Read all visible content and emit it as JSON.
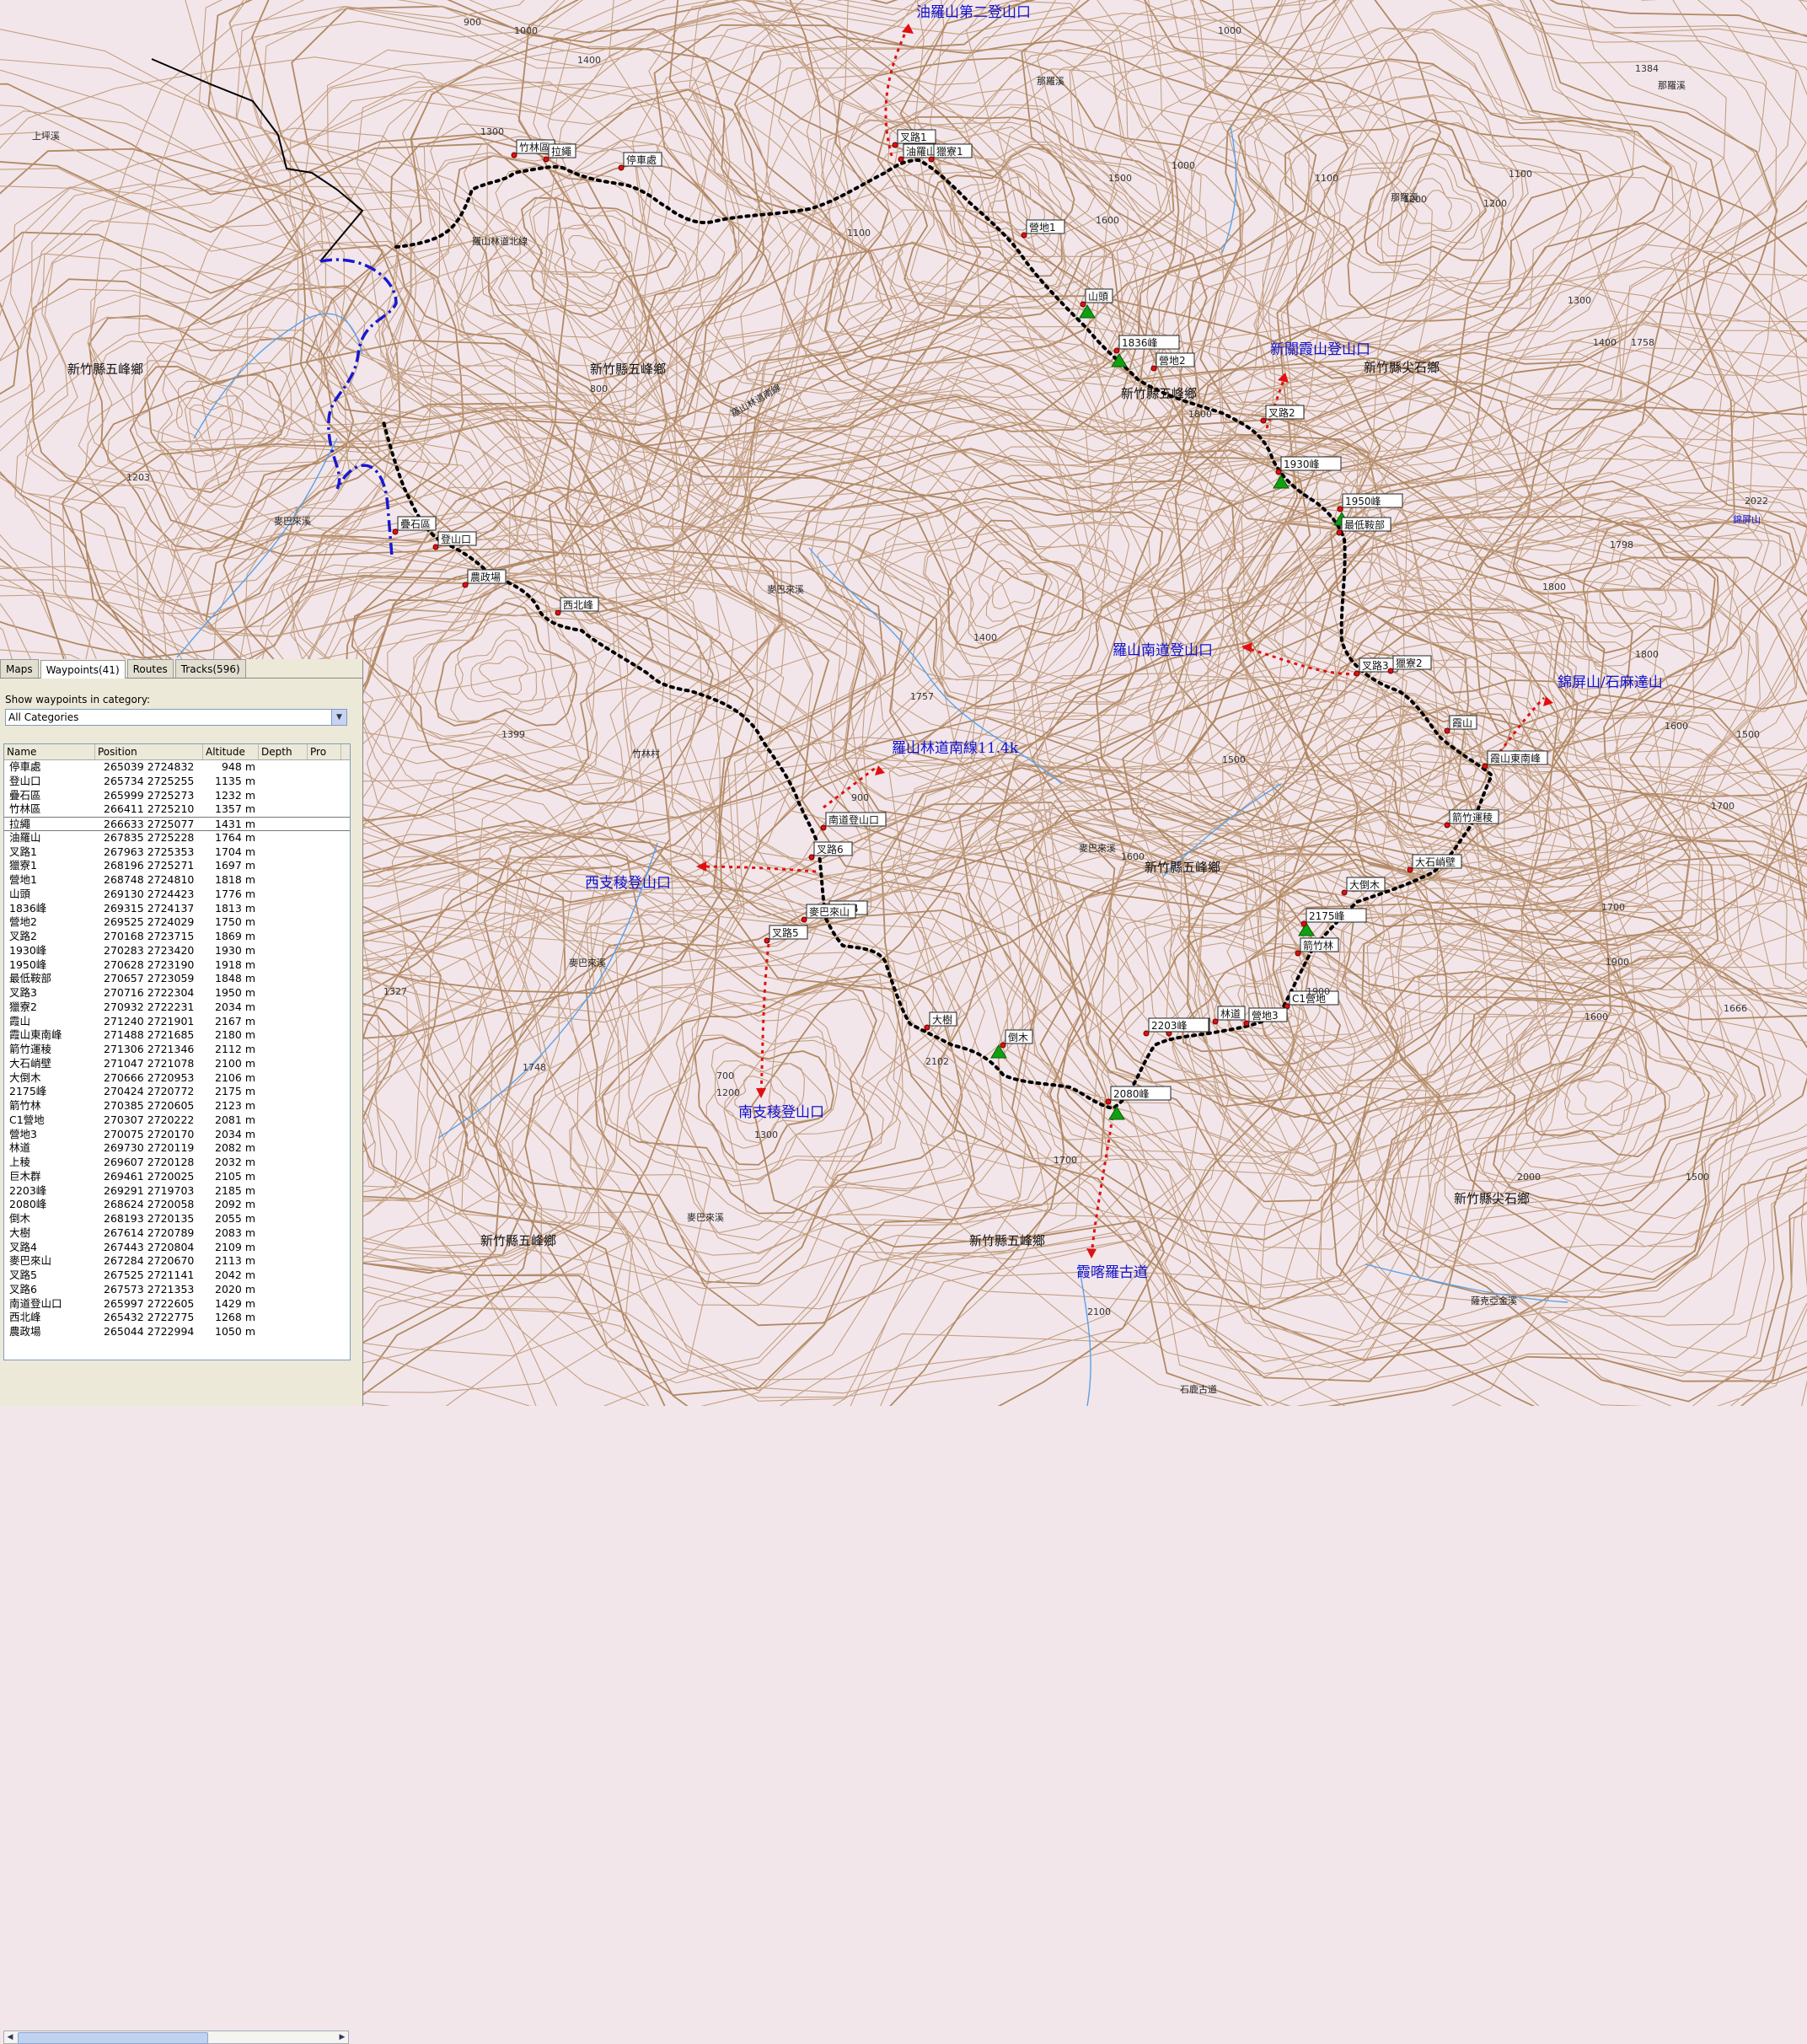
{
  "map": {
    "trail_labels": [
      {
        "id": "youluo2",
        "text": "油羅山第二登山口"
      },
      {
        "id": "xinguan",
        "text": "新關霞山登山口"
      },
      {
        "id": "luoshan_south",
        "text": "羅山南道登山口"
      },
      {
        "id": "jinping",
        "text": "錦屏山/石麻達山"
      },
      {
        "id": "linroad",
        "text": "羅山林道南線11.4k"
      },
      {
        "id": "west",
        "text": "西支稜登山口"
      },
      {
        "id": "south",
        "text": "南支稜登山口"
      },
      {
        "id": "xiake",
        "text": "霞喀羅古道"
      }
    ],
    "region_labels": [
      {
        "id": "r1",
        "text": "新竹縣五峰鄉"
      },
      {
        "id": "r2",
        "text": "新竹縣五峰鄉"
      },
      {
        "id": "r3",
        "text": "新竹縣尖石鄉"
      },
      {
        "id": "r4",
        "text": "新竹縣五峰鄉"
      },
      {
        "id": "r5",
        "text": "新竹縣五峰鄉"
      },
      {
        "id": "r6",
        "text": "新竹縣五峰鄉"
      },
      {
        "id": "r7",
        "text": "新竹縣五峰鄉"
      },
      {
        "id": "r8",
        "text": "新竹縣尖石鄉"
      }
    ],
    "place_labels": [
      {
        "id": "p1",
        "text": "上坪溪"
      },
      {
        "id": "p2",
        "text": "麥巴來溪"
      },
      {
        "id": "p3",
        "text": "麥巴來溪"
      },
      {
        "id": "p4",
        "text": "竹林村"
      },
      {
        "id": "p5",
        "text": "麥巴來溪"
      },
      {
        "id": "p6",
        "text": "麥巴來溪"
      },
      {
        "id": "p7",
        "text": "那羅溪"
      },
      {
        "id": "p8",
        "text": "那羅溪"
      },
      {
        "id": "p9",
        "text": "那羅溪"
      },
      {
        "id": "p10",
        "text": "錦屏山"
      },
      {
        "id": "p11",
        "text": "羅山林道北線"
      },
      {
        "id": "p12",
        "text": "羅山林道南線"
      },
      {
        "id": "p13",
        "text": "麥巴來溪"
      },
      {
        "id": "p14",
        "text": "薩克亞金溪"
      },
      {
        "id": "p15",
        "text": "石鹿古道"
      }
    ],
    "waypoint_labels": [
      "叉路1",
      "油羅山",
      "獵寮1",
      "營地1",
      "山頭",
      "1836峰",
      "營地2",
      "叉路2",
      "1930峰",
      "1950峰",
      "最低鞍部",
      "叉路3",
      "獵寮2",
      "霞山",
      "霞山東南峰",
      "箭竹運稜",
      "大石峭壁",
      "大倒木",
      "2175峰",
      "箭竹林",
      "C1營地",
      "營地3",
      "林道",
      "巨木群",
      "2203峰",
      "2080峰",
      "倒木",
      "大樹",
      "叉路4",
      "麥巴來山",
      "叉路5",
      "叉路6",
      "南道登山口",
      "西北峰",
      "農政場",
      "登山口",
      "疊石區",
      "竹林區",
      "拉繩",
      "停車處"
    ],
    "contour_numbers": [
      "900",
      "1000",
      "1400",
      "1300",
      "1500",
      "1600",
      "1200",
      "1100",
      "1000",
      "1384",
      "1100",
      "1200",
      "1300",
      "1400",
      "1500",
      "1600",
      "1700",
      "1800",
      "1900",
      "2000",
      "2100",
      "1758",
      "1800",
      "1900",
      "1700",
      "1600",
      "1500",
      "1300",
      "1200",
      "1100",
      "1000",
      "700",
      "800",
      "900",
      "1203",
      "1399",
      "1327",
      "1748",
      "1757",
      "1666",
      "1798",
      "1800",
      "1700",
      "1600",
      "1500",
      "1400",
      "2102",
      "2022"
    ]
  },
  "panel": {
    "tabs": [
      {
        "label": "Maps",
        "active": false
      },
      {
        "label": "Waypoints(41)",
        "active": true
      },
      {
        "label": "Routes",
        "active": false
      },
      {
        "label": "Tracks(596)",
        "active": false
      }
    ],
    "category_label": "Show waypoints in category:",
    "category_value": "All Categories",
    "columns": [
      "Name",
      "Position",
      "Altitude",
      "Depth",
      "Pro"
    ],
    "rows": [
      {
        "name": "停車處",
        "pos": "265039 2724832",
        "alt": "948 m"
      },
      {
        "name": "登山口",
        "pos": "265734 2725255",
        "alt": "1135 m"
      },
      {
        "name": "疊石區",
        "pos": "265999 2725273",
        "alt": "1232 m"
      },
      {
        "name": "竹林區",
        "pos": "266411 2725210",
        "alt": "1357 m"
      },
      {
        "name": "拉繩",
        "pos": "266633 2725077",
        "alt": "1431 m"
      },
      {
        "name": "油羅山",
        "pos": "267835 2725228",
        "alt": "1764 m"
      },
      {
        "name": "叉路1",
        "pos": "267963 2725353",
        "alt": "1704 m"
      },
      {
        "name": "獵寮1",
        "pos": "268196 2725271",
        "alt": "1697 m"
      },
      {
        "name": "營地1",
        "pos": "268748 2724810",
        "alt": "1818 m"
      },
      {
        "name": "山頭",
        "pos": "269130 2724423",
        "alt": "1776 m"
      },
      {
        "name": "1836峰",
        "pos": "269315 2724137",
        "alt": "1813 m"
      },
      {
        "name": "營地2",
        "pos": "269525 2724029",
        "alt": "1750 m"
      },
      {
        "name": "叉路2",
        "pos": "270168 2723715",
        "alt": "1869 m"
      },
      {
        "name": "1930峰",
        "pos": "270283 2723420",
        "alt": "1930 m"
      },
      {
        "name": "1950峰",
        "pos": "270628 2723190",
        "alt": "1918 m"
      },
      {
        "name": "最低鞍部",
        "pos": "270657 2723059",
        "alt": "1848 m"
      },
      {
        "name": "叉路3",
        "pos": "270716 2722304",
        "alt": "1950 m"
      },
      {
        "name": "獵寮2",
        "pos": "270932 2722231",
        "alt": "2034 m"
      },
      {
        "name": "霞山",
        "pos": "271240 2721901",
        "alt": "2167 m"
      },
      {
        "name": "霞山東南峰",
        "pos": "271488 2721685",
        "alt": "2180 m"
      },
      {
        "name": "箭竹運稜",
        "pos": "271306 2721346",
        "alt": "2112 m"
      },
      {
        "name": "大石峭壁",
        "pos": "271047 2721078",
        "alt": "2100 m"
      },
      {
        "name": "大倒木",
        "pos": "270666 2720953",
        "alt": "2106 m"
      },
      {
        "name": "2175峰",
        "pos": "270424 2720772",
        "alt": "2175 m"
      },
      {
        "name": "箭竹林",
        "pos": "270385 2720605",
        "alt": "2123 m"
      },
      {
        "name": "C1營地",
        "pos": "270307 2720222",
        "alt": "2081 m"
      },
      {
        "name": "營地3",
        "pos": "270075 2720170",
        "alt": "2034 m"
      },
      {
        "name": "林道",
        "pos": "269730 2720119",
        "alt": "2082 m"
      },
      {
        "name": "上稜",
        "pos": "269607 2720128",
        "alt": "2032 m"
      },
      {
        "name": "巨木群",
        "pos": "269461 2720025",
        "alt": "2105 m"
      },
      {
        "name": "2203峰",
        "pos": "269291 2719703",
        "alt": "2185 m"
      },
      {
        "name": "2080峰",
        "pos": "268624 2720058",
        "alt": "2092 m"
      },
      {
        "name": "倒木",
        "pos": "268193 2720135",
        "alt": "2055 m"
      },
      {
        "name": "大樹",
        "pos": "267614 2720789",
        "alt": "2083 m"
      },
      {
        "name": "叉路4",
        "pos": "267443 2720804",
        "alt": "2109 m"
      },
      {
        "name": "麥巴來山",
        "pos": "267284 2720670",
        "alt": "2113 m"
      },
      {
        "name": "叉路5",
        "pos": "267525 2721141",
        "alt": "2042 m"
      },
      {
        "name": "叉路6",
        "pos": "267573 2721353",
        "alt": "2020 m"
      },
      {
        "name": "南道登山口",
        "pos": "265997 2722605",
        "alt": "1429 m"
      },
      {
        "name": "西北峰",
        "pos": "265432 2722775",
        "alt": "1268 m"
      },
      {
        "name": "農政場",
        "pos": "265044 2722994",
        "alt": "1050 m"
      }
    ]
  },
  "colors": {
    "contour": "#b48860",
    "index_contour": "#a0703c",
    "trail": "#000000",
    "route": "#e01010",
    "river": "#5aa0e8",
    "road": "#1818d0",
    "panel_bg": "#ece9d8"
  }
}
